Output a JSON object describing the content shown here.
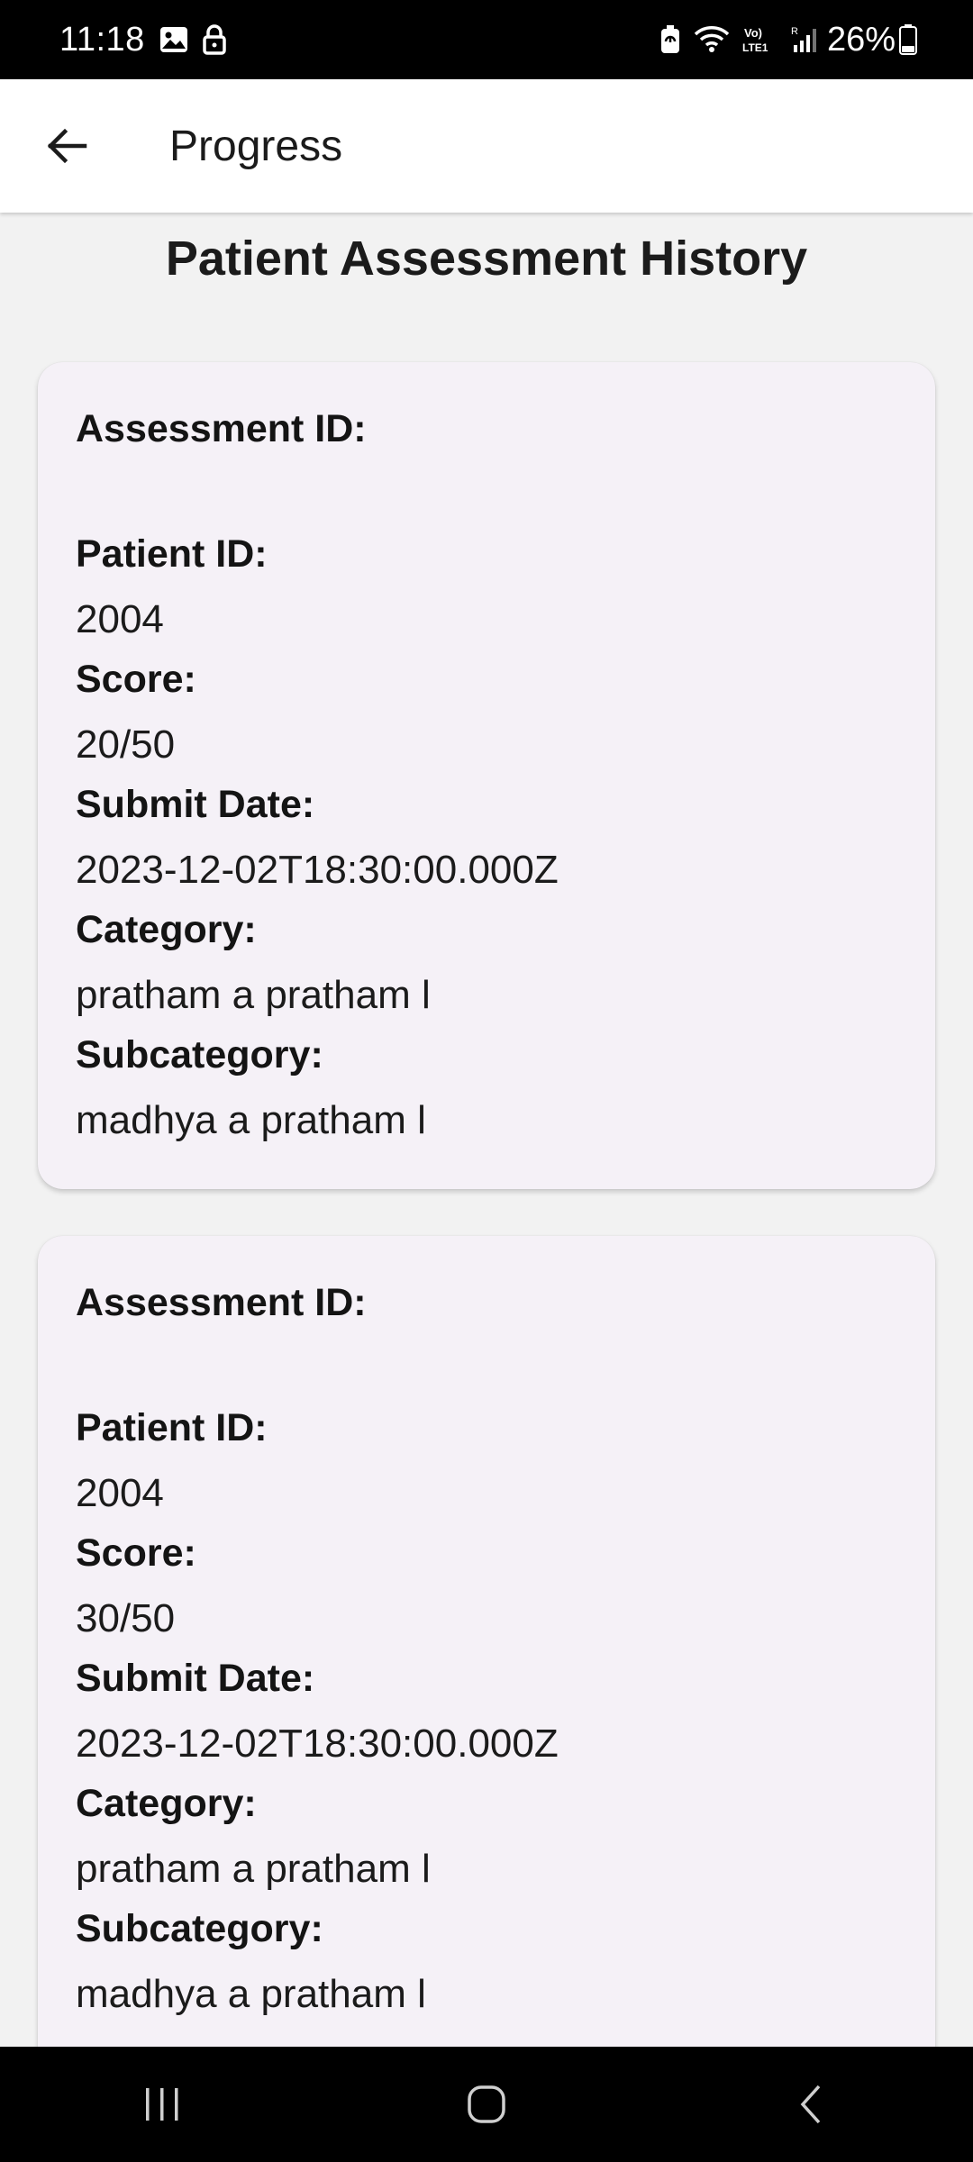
{
  "status_bar": {
    "time": "11:18",
    "battery_percent": "26%",
    "icons": [
      "gallery-icon",
      "lock-icon",
      "battery-saver-icon",
      "wifi-icon",
      "volte-icon",
      "signal-icon",
      "battery-icon"
    ]
  },
  "app_bar": {
    "title": "Progress",
    "back_icon": "arrow-left-icon"
  },
  "page": {
    "heading": "Patient Assessment History"
  },
  "labels": {
    "assessment_id": "Assessment ID:",
    "patient_id": "Patient ID:",
    "score": "Score:",
    "submit_date": "Submit Date:",
    "category": "Category:",
    "subcategory": "Subcategory:"
  },
  "assessments": [
    {
      "assessment_id": "",
      "patient_id": "2004",
      "score": "20/50",
      "submit_date": "2023-12-02T18:30:00.000Z",
      "category": "pratham a pratham l",
      "subcategory": "madhya a pratham l"
    },
    {
      "assessment_id": "",
      "patient_id": "2004",
      "score": "30/50",
      "submit_date": "2023-12-02T18:30:00.000Z",
      "category": "pratham a pratham l",
      "subcategory": "madhya a pratham l"
    }
  ],
  "nav_bar": {
    "buttons": [
      "recents-icon",
      "home-icon",
      "back-icon"
    ]
  }
}
